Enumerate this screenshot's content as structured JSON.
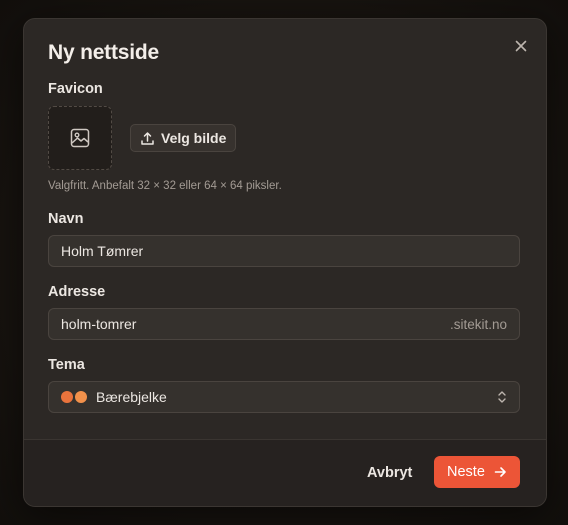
{
  "dialog": {
    "title": "Ny nettside",
    "close_icon": "close-icon"
  },
  "favicon": {
    "label": "Favicon",
    "placeholder_icon": "image-icon",
    "upload_icon": "upload-icon",
    "upload_label": "Velg bilde",
    "hint": "Valgfritt. Anbefalt 32 × 32 eller 64 × 64 piksler."
  },
  "name": {
    "label": "Navn",
    "value": "Holm Tømrer"
  },
  "address": {
    "label": "Adresse",
    "value": "holm-tomrer",
    "suffix": ".sitekit.no"
  },
  "theme": {
    "label": "Tema",
    "selected": "Bærebjelke",
    "swatch_colors": [
      "#e9733c",
      "#f2914b"
    ],
    "chevron_icon": "chevron-up-down-icon"
  },
  "footer": {
    "cancel_label": "Avbryt",
    "next_label": "Neste",
    "next_icon": "arrow-right-icon",
    "accent_color": "#ec5537"
  }
}
